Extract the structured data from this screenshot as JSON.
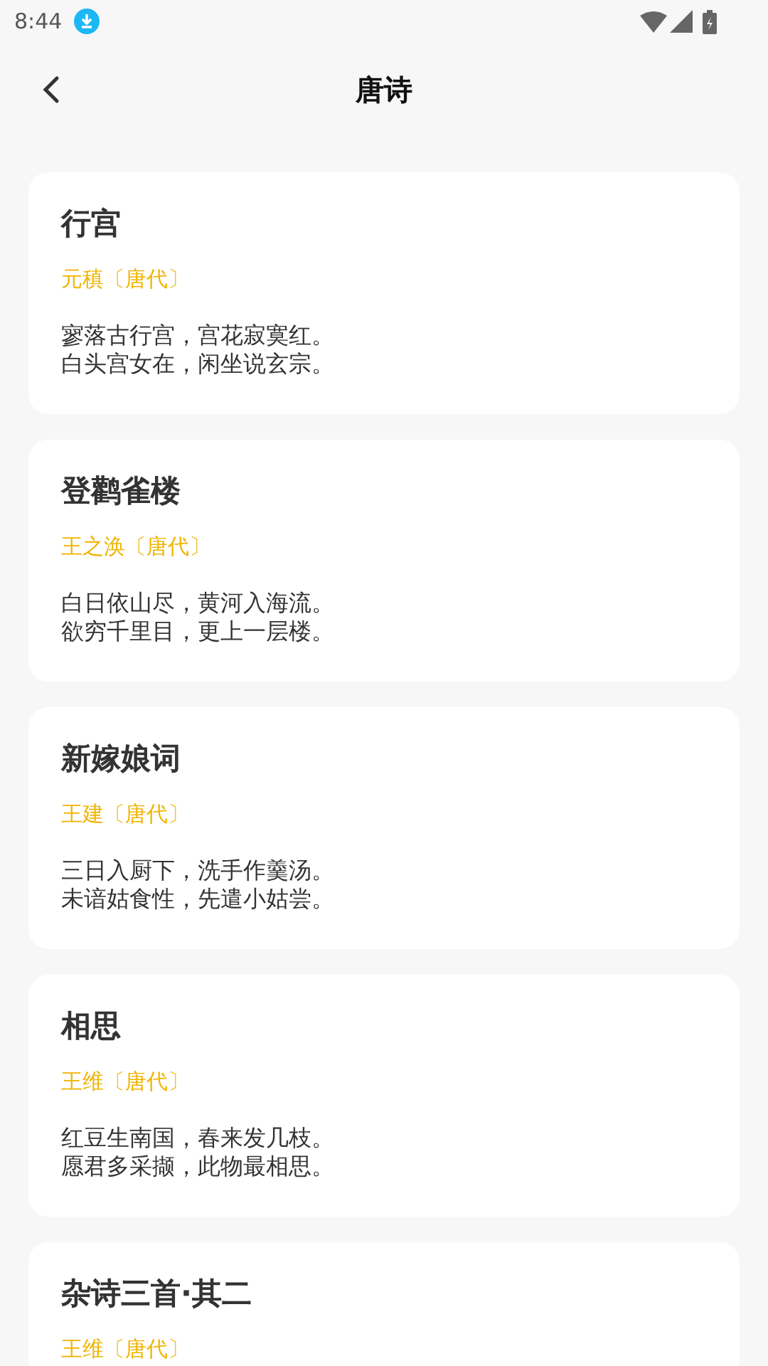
{
  "status_bar": {
    "time": "8:44"
  },
  "header": {
    "title": "唐诗"
  },
  "poems": [
    {
      "title": "行宫",
      "author": "元稹〔唐代〕",
      "lines": [
        "寥落古行宫，宫花寂寞红。",
        "白头宫女在，闲坐说玄宗。"
      ]
    },
    {
      "title": "登鹳雀楼",
      "author": "王之涣〔唐代〕",
      "lines": [
        "白日依山尽，黄河入海流。",
        "欲穷千里目，更上一层楼。"
      ]
    },
    {
      "title": "新嫁娘词",
      "author": "王建〔唐代〕",
      "lines": [
        "三日入厨下，洗手作羹汤。",
        "未谙姑食性，先遣小姑尝。"
      ]
    },
    {
      "title": "相思",
      "author": "王维〔唐代〕",
      "lines": [
        "红豆生南国，春来发几枝。",
        "愿君多采撷，此物最相思。"
      ]
    },
    {
      "title": "杂诗三首·其二",
      "author": "王维〔唐代〕"
    }
  ]
}
